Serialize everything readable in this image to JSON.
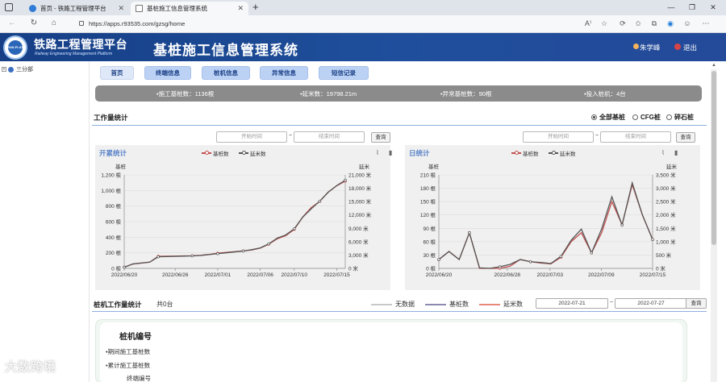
{
  "browser": {
    "tabs": [
      {
        "title": "首页 - 铁路工程管理平台"
      },
      {
        "title": "基桩施工信息管理系统"
      }
    ],
    "new_tab": "+",
    "url": "https://apps.r93535.com/gzsg/home",
    "window_controls": [
      "—",
      "❐",
      "✕"
    ]
  },
  "header": {
    "logo_text": "RAILPLAT",
    "platform_title": "铁路工程管理平台",
    "platform_subtitle": "Railway Engineering Management Platform",
    "system_title": "基桩施工信息管理系统",
    "user": "朱学峰",
    "logout": "退出"
  },
  "tree": {
    "root": "三分部"
  },
  "nav": {
    "home": "首页",
    "terminal": "终端信息",
    "pile": "桩机信息",
    "anomaly": "异常信息",
    "sms": "短信记录"
  },
  "summary": {
    "items": [
      "•施工基桩数：1136根",
      "•延米数：19798.21m",
      "•异常基桩数：90根",
      "•投入桩机：4台"
    ]
  },
  "workload": {
    "title": "工作量统计",
    "filters": [
      "全部基桩",
      "CFG桩",
      "碎石桩"
    ],
    "selected_filter": "全部基桩",
    "start_placeholder": "开始时间",
    "end_placeholder": "结束时间",
    "tilde": "~",
    "query": "查询"
  },
  "charts": {
    "legend_piles": "基桩数",
    "legend_meters": "延米数",
    "left_axis_label": "基桩",
    "right_axis_label": "延米",
    "cumulative_title": "开累统计",
    "daily_title": "日统计"
  },
  "chart_data": [
    {
      "type": "line",
      "title": "开累统计",
      "ylabel": "基桩",
      "y2label": "延米",
      "ylim": [
        0,
        1200
      ],
      "y2lim": [
        0,
        21000
      ],
      "yticks": [
        "0 根",
        "200 根",
        "400 根",
        "600 根",
        "800 根",
        "1,000 根",
        "1,200 根"
      ],
      "y2ticks": [
        "0 米",
        "3,000 米",
        "6,000 米",
        "9,000 米",
        "12,000 米",
        "15,000 米",
        "18,000 米",
        "21,000 米"
      ],
      "xticks": [
        "2022/06/20",
        "2022/06/26",
        "2022/07/01",
        "2022/07/06",
        "2022/07/10",
        "2022/07/15"
      ],
      "x": [
        "2022/06/20",
        "2022/06/21",
        "2022/06/23",
        "2022/06/24",
        "2022/06/26",
        "2022/06/27",
        "2022/06/28",
        "2022/06/29",
        "2022/06/30",
        "2022/07/01",
        "2022/07/02",
        "2022/07/03",
        "2022/07/04",
        "2022/07/05",
        "2022/07/06",
        "2022/07/07",
        "2022/07/08",
        "2022/07/09",
        "2022/07/10",
        "2022/07/11",
        "2022/07/12",
        "2022/07/13",
        "2022/07/14",
        "2022/07/15",
        "2022/07/16"
      ],
      "series": [
        {
          "name": "基桩数",
          "color": "#c0504d",
          "axis": "left",
          "values": [
            15,
            55,
            80,
            155,
            158,
            160,
            162,
            168,
            180,
            195,
            205,
            215,
            225,
            235,
            260,
            310,
            380,
            420,
            500,
            660,
            780,
            860,
            980,
            1060,
            1120
          ]
        },
        {
          "name": "延米数",
          "color": "#555555",
          "axis": "right",
          "values": [
            250,
            1000,
            1400,
            2600,
            2700,
            2750,
            2800,
            2900,
            3100,
            3300,
            3500,
            3700,
            3900,
            4200,
            4600,
            5500,
            6800,
            7500,
            8900,
            11500,
            13400,
            15100,
            17100,
            18600,
            19800
          ]
        }
      ]
    },
    {
      "type": "line",
      "title": "日统计",
      "ylabel": "基桩",
      "y2label": "延米",
      "ylim": [
        0,
        210
      ],
      "y2lim": [
        0,
        3500
      ],
      "yticks": [
        "0 根",
        "30 根",
        "60 根",
        "90 根",
        "120 根",
        "150 根",
        "180 根",
        "210 根"
      ],
      "y2ticks": [
        "0 米",
        "500 米",
        "1,000 米",
        "1,500 米",
        "2,000 米",
        "2,500 米",
        "3,000 米",
        "3,500 米"
      ],
      "xticks": [
        "2022/06/20",
        "2022/06/28",
        "2022/07/03",
        "2022/07/09",
        "2022/07/15"
      ],
      "x": [
        "2022/06/20",
        "2022/06/21",
        "2022/06/22",
        "2022/06/23",
        "2022/06/25",
        "2022/06/26",
        "2022/06/27",
        "2022/06/28",
        "2022/06/29",
        "2022/06/30",
        "2022/07/01",
        "2022/07/02",
        "2022/07/03",
        "2022/07/04",
        "2022/07/05",
        "2022/07/06",
        "2022/07/07",
        "2022/07/08",
        "2022/07/09",
        "2022/07/10",
        "2022/07/11",
        "2022/07/12",
        "2022/07/13",
        "2022/07/14",
        "2022/07/15"
      ],
      "series": [
        {
          "name": "基桩数",
          "color": "#c0504d",
          "axis": "left",
          "values": [
            20,
            38,
            20,
            80,
            0,
            0,
            0,
            5,
            20,
            15,
            12,
            10,
            25,
            60,
            80,
            35,
            80,
            150,
            98,
            188,
            120,
            65
          ]
        },
        {
          "name": "延米数",
          "color": "#555555",
          "axis": "right",
          "values": [
            330,
            630,
            330,
            1330,
            20,
            0,
            60,
            150,
            330,
            250,
            220,
            180,
            450,
            1050,
            1470,
            580,
            1480,
            2680,
            1620,
            3200,
            2000,
            1080
          ]
        }
      ]
    }
  ],
  "pile_work": {
    "title": "桩机工作量统计",
    "count": "共0台",
    "legend": [
      {
        "label": "无数据",
        "color": "#c8c8c8"
      },
      {
        "label": "基桩数",
        "color": "#8c8ab0"
      },
      {
        "label": "延米数",
        "color": "#e88a7a"
      }
    ],
    "start_date": "2022-07-21",
    "end_date": "2022-07-27",
    "query": "查询"
  },
  "card": {
    "title": "桩机编号",
    "rows": [
      "•期间施工基桩数",
      "•累计施工基桩数",
      "终端编号"
    ]
  },
  "watermark": "大数跨境"
}
